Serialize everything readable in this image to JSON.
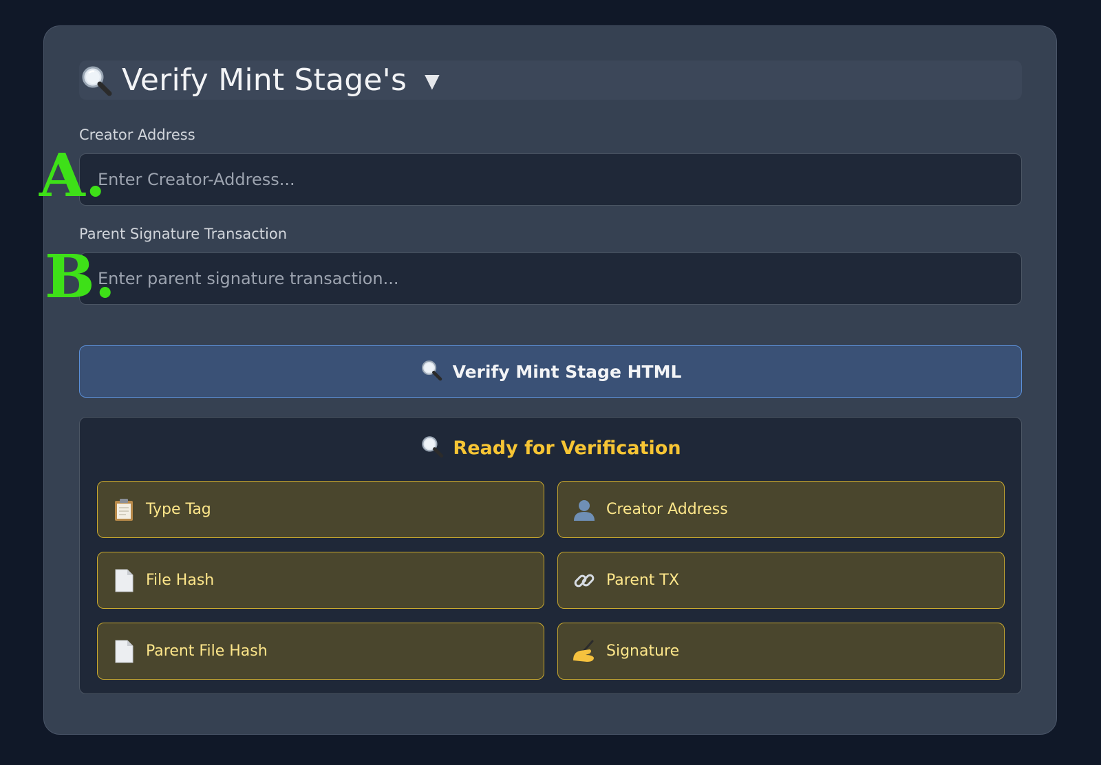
{
  "header": {
    "title": "Verify Mint Stage's",
    "icon": "magnifier-icon",
    "toggle_icon": "caret-down-icon"
  },
  "form": {
    "creator_label": "Creator Address",
    "creator_placeholder": "Enter Creator-Address...",
    "creator_value": "",
    "parent_label": "Parent Signature Transaction",
    "parent_placeholder": "Enter parent signature transaction...",
    "parent_value": ""
  },
  "markers": {
    "a": "A.",
    "b": "B."
  },
  "verify_button": {
    "label": "Verify Mint Stage HTML",
    "icon": "magnifier-icon"
  },
  "results": {
    "title": "Ready for Verification",
    "icon": "magnifier-icon",
    "items": [
      {
        "label": "Type Tag",
        "icon": "clipboard-icon"
      },
      {
        "label": "Creator Address",
        "icon": "user-icon"
      },
      {
        "label": "File Hash",
        "icon": "document-icon"
      },
      {
        "label": "Parent TX",
        "icon": "link-icon"
      },
      {
        "label": "Parent File Hash",
        "icon": "document-icon"
      },
      {
        "label": "Signature",
        "icon": "writing-hand-icon"
      }
    ]
  },
  "colors": {
    "background": "#101828",
    "panel": "#364152",
    "accent_blue": "#5b8fd8",
    "status_yellow": "#f7c534",
    "item_border": "#c9a92f",
    "marker_green": "#3ee018"
  }
}
